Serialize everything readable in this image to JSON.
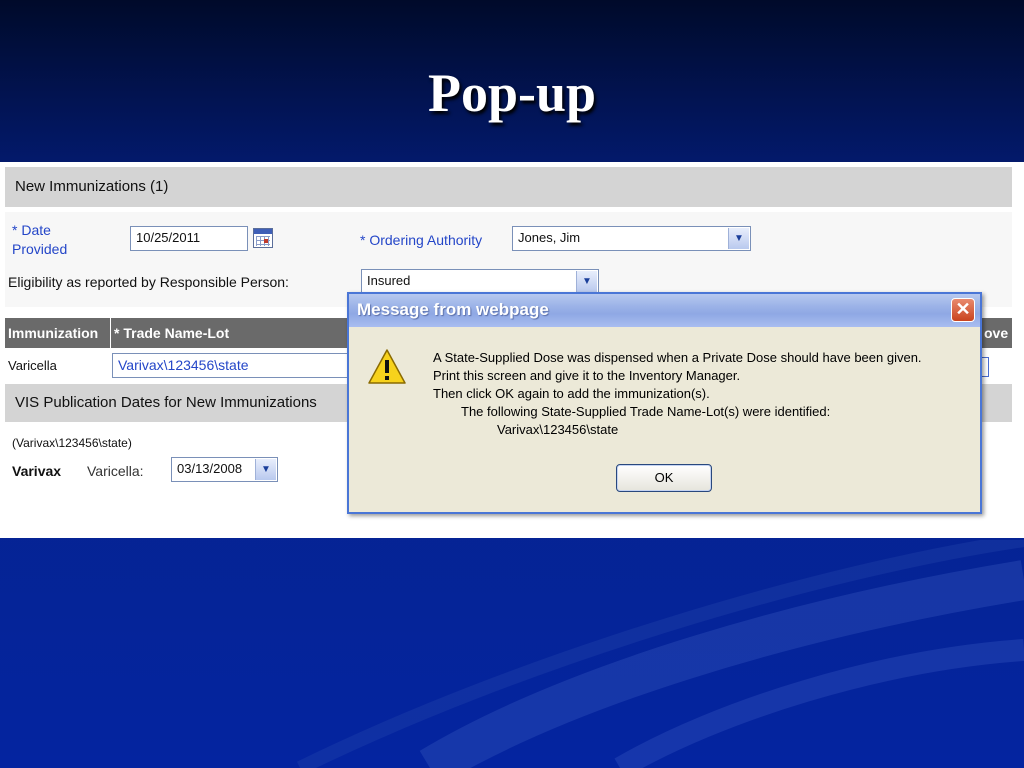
{
  "slide": {
    "title": "Pop-up"
  },
  "form": {
    "section_title": "New Immunizations (1)",
    "date_label_line1": "* Date",
    "date_label_line2": "Provided",
    "date_value": "10/25/2011",
    "ordering_authority_label": "* Ordering Authority",
    "ordering_authority_value": "Jones, Jim",
    "eligibility_label": "Eligibility as reported by Responsible Person:",
    "eligibility_value": "Insured"
  },
  "table": {
    "columns": [
      "Immunization",
      "* Trade Name-Lot",
      "ove"
    ],
    "rows": [
      {
        "immunization": "Varicella",
        "trade_name_lot": "Varivax\\123456\\state"
      }
    ]
  },
  "vis": {
    "section_title": "VIS Publication Dates for New Immunizations",
    "trade_note": "(Varivax\\123456\\state)",
    "vaccine": "Varivax",
    "disease_label": "Varicella:",
    "date_value": "03/13/2008"
  },
  "dialog": {
    "title": "Message from webpage",
    "close_glyph": "✕",
    "lines": [
      "A State-Supplied Dose was dispensed when a Private Dose should have been given.",
      "Print this screen and give it to the Inventory Manager.",
      "Then click OK again to add the immunization(s).",
      "The following State-Supplied Trade Name-Lot(s) were identified:",
      "Varivax\\123456\\state"
    ],
    "ok_label": "OK"
  },
  "icons": {
    "calendar": "calendar-icon",
    "dropdown": "chevron-down-icon",
    "warning": "warning-icon",
    "close": "close-icon"
  },
  "colors": {
    "slide_background": "#06238f",
    "label_blue": "#2446c8",
    "dialog_border": "#4a76d6",
    "dialog_body": "#ece9d8",
    "table_header": "#6a6a6a"
  }
}
